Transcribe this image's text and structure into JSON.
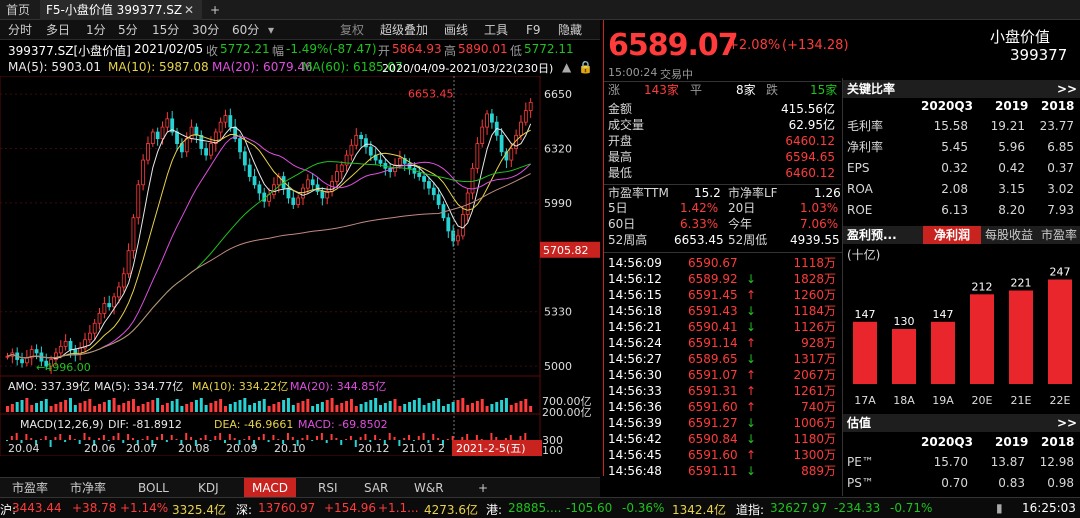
{
  "tabs": {
    "home": "首页",
    "current": "F5-小盘价值 399377.SZ",
    "add": "+"
  },
  "toolbar": {
    "periods": [
      "分时",
      "多日",
      "1分",
      "5分",
      "15分",
      "30分",
      "60分"
    ],
    "dropdown": "▾",
    "actions": [
      "复权",
      "超级叠加",
      "画线",
      "工具",
      "F9",
      "隐藏"
    ]
  },
  "info": {
    "name": "399377.SZ[小盘价值]",
    "date": "2021/02/05",
    "close_label": "收",
    "close": "5772.21",
    "change_label": "幅",
    "change": "-1.49%(-87.47)",
    "open_label": "开",
    "open": "5864.93",
    "high_label": "高",
    "high": "5890.01",
    "low_label": "低",
    "low": "5772.11"
  },
  "ma": {
    "ma5": "MA(5): 5903.01",
    "ma10": "MA(10): 5987.08",
    "ma20": "MA(20): 6079.46",
    "ma60": "MA(60): 6185.07",
    "range": "2020/04/09-2021/03/22(230日)"
  },
  "chart_data": {
    "type": "candlestick",
    "price_ticks": [
      "6650",
      "6320",
      "5990",
      "5705.82",
      "5330",
      "5000"
    ],
    "current_price_marker": "5705.82",
    "max_label": "6653.45",
    "min_label": "4996.00",
    "x_labels": [
      "20.04",
      "20.06",
      "20.07",
      "20.08",
      "20.09",
      "20.10",
      "20.12",
      "21.01",
      "2"
    ],
    "cursor_date": "2021-2-5(五)",
    "amo_ticks": [
      "700.00亿",
      "200.00亿"
    ],
    "macd_ticks": [
      "300",
      "100"
    ],
    "ylim": [
      4940,
      6760
    ],
    "closes": [
      5060,
      5080,
      5040,
      5020,
      5050,
      5100,
      5080,
      5030,
      5000,
      5040,
      5080,
      5120,
      5150,
      5100,
      5070,
      5110,
      5160,
      5200,
      5260,
      5320,
      5380,
      5360,
      5420,
      5480,
      5560,
      5700,
      5900,
      6100,
      6250,
      6350,
      6420,
      6380,
      6450,
      6500,
      6420,
      6350,
      6300,
      6380,
      6450,
      6400,
      6320,
      6280,
      6350,
      6420,
      6480,
      6520,
      6450,
      6380,
      6300,
      6220,
      6150,
      6100,
      6050,
      6000,
      6040,
      6100,
      6150,
      6080,
      6020,
      5980,
      6020,
      6080,
      6130,
      6100,
      6060,
      6020,
      6060,
      6120,
      6180,
      6220,
      6280,
      6340,
      6400,
      6380,
      6330,
      6280,
      6250,
      6230,
      6200,
      6180,
      6220,
      6260,
      6230,
      6200,
      6170,
      6150,
      6120,
      6080,
      6040,
      5980,
      5900,
      5820,
      5760,
      5790,
      5920,
      6050,
      6200,
      6350,
      6450,
      6530,
      6480,
      6400,
      6300,
      6250,
      6320,
      6400,
      6480,
      6550,
      6600
    ]
  },
  "sub": {
    "amo": "AMO: 337.39亿",
    "amo_ma5": "MA(5): 334.77亿",
    "amo_ma10": "MA(10): 334.22亿",
    "amo_ma20": "MA(20): 344.85亿",
    "macd": "MACD(12,26,9)",
    "dif": "DIF: -81.8912",
    "dea": "DEA: -46.9661",
    "macd_val": "MACD: -69.8502"
  },
  "bottom_tabs": [
    "市盈率",
    "市净率",
    "BOLL",
    "KDJ",
    "MACD",
    "RSI",
    "SAR",
    "W&R",
    "+"
  ],
  "quote": {
    "price": "6589.07",
    "pct": "+2.08%",
    "chg": "(+134.28)",
    "name": "小盘价值",
    "code": "399377",
    "time": "15:00:24",
    "status": "交易中",
    "up_label": "涨",
    "up": "143家",
    "flat_label": "平",
    "flat": "8家",
    "down_label": "跌",
    "down": "15家",
    "stats": [
      {
        "k": "金额",
        "v": "415.56亿",
        "c": "white"
      },
      {
        "k": "成交量",
        "v": "62.95亿",
        "c": "white"
      },
      {
        "k": "开盘",
        "v": "6460.12",
        "c": "red"
      },
      {
        "k": "最高",
        "v": "6594.65",
        "c": "red"
      },
      {
        "k": "最低",
        "v": "6460.12",
        "c": "red"
      }
    ],
    "pe_label": "市盈率TTM",
    "pe": "15.2",
    "pb_label": "市净率LF",
    "pb": "1.26",
    "d5_label": "5日",
    "d5": "1.42%",
    "d20_label": "20日",
    "d20": "1.03%",
    "d60_label": "60日",
    "d60": "6.33%",
    "ytd_label": "今年",
    "ytd": "7.06%",
    "h52_label": "52周高",
    "h52": "6653.45",
    "l52_label": "52周低",
    "l52": "4939.55"
  },
  "ticks": [
    {
      "t": "14:56:09",
      "p": "6590.67",
      "a": "",
      "v": "1118万"
    },
    {
      "t": "14:56:12",
      "p": "6589.92",
      "a": "↓",
      "v": "1828万"
    },
    {
      "t": "14:56:15",
      "p": "6591.45",
      "a": "↑",
      "v": "1260万"
    },
    {
      "t": "14:56:18",
      "p": "6591.43",
      "a": "↓",
      "v": "1184万"
    },
    {
      "t": "14:56:21",
      "p": "6590.41",
      "a": "↓",
      "v": "1126万"
    },
    {
      "t": "14:56:24",
      "p": "6591.14",
      "a": "↑",
      "v": "928万"
    },
    {
      "t": "14:56:27",
      "p": "6589.65",
      "a": "↓",
      "v": "1317万"
    },
    {
      "t": "14:56:30",
      "p": "6591.07",
      "a": "↑",
      "v": "2067万"
    },
    {
      "t": "14:56:33",
      "p": "6591.31",
      "a": "↑",
      "v": "1261万"
    },
    {
      "t": "14:56:36",
      "p": "6591.60",
      "a": "↑",
      "v": "740万"
    },
    {
      "t": "14:56:39",
      "p": "6591.27",
      "a": "↓",
      "v": "1006万"
    },
    {
      "t": "14:56:42",
      "p": "6590.84",
      "a": "↓",
      "v": "1180万"
    },
    {
      "t": "14:56:45",
      "p": "6591.60",
      "a": "↑",
      "v": "1300万"
    },
    {
      "t": "14:56:48",
      "p": "6591.11",
      "a": "↓",
      "v": "889万"
    }
  ],
  "ratios": {
    "title": "关键比率",
    "more": ">>",
    "cols": [
      "2020Q3",
      "2019",
      "2018"
    ],
    "rows": [
      {
        "k": "毛利率",
        "v": [
          "15.58",
          "19.21",
          "23.77"
        ]
      },
      {
        "k": "净利率",
        "v": [
          "5.45",
          "5.96",
          "6.85"
        ]
      },
      {
        "k": "EPS",
        "v": [
          "0.32",
          "0.42",
          "0.37"
        ]
      },
      {
        "k": "ROA",
        "v": [
          "2.08",
          "3.15",
          "3.02"
        ]
      },
      {
        "k": "ROE",
        "v": [
          "6.13",
          "8.20",
          "7.93"
        ]
      }
    ]
  },
  "forecast": {
    "title": "盈利预...",
    "tabs": [
      "净利润",
      "每股收益",
      "市盈率"
    ],
    "unit": "(十亿)",
    "categories": [
      "17A",
      "18A",
      "19A",
      "20E",
      "21E",
      "22E"
    ],
    "values": [
      147,
      130,
      147,
      212,
      221,
      247
    ],
    "color": "#e8262b"
  },
  "valuation": {
    "title": "估值",
    "more": ">>",
    "cols": [
      "2020Q3",
      "2019",
      "2018"
    ],
    "rows": [
      {
        "k": "PE™",
        "v": [
          "15.70",
          "13.87",
          "12.98"
        ]
      },
      {
        "k": "PS™",
        "v": [
          "0.70",
          "0.83",
          "0.98"
        ]
      }
    ]
  },
  "status": {
    "sh_label": "沪:",
    "sh": "3443.44",
    "sh_chg": "+38.78",
    "sh_pct": "+1.14%",
    "sh_amt": "3325.4亿",
    "sz_label": "深:",
    "sz": "13760.97",
    "sz_chg": "+154.96",
    "sz_pct": "+1.1...",
    "sz_amt": "4273.6亿",
    "hk_label": "港:",
    "hk": "28885....",
    "hk_chg": "-105.60",
    "hk_pct": "-0.36%",
    "hk_amt": "1342.4亿",
    "dj_label": "道指:",
    "dj": "32627.97",
    "dj_chg": "-234.33",
    "dj_pct": "-0.71%",
    "clock": "16:25:03"
  }
}
